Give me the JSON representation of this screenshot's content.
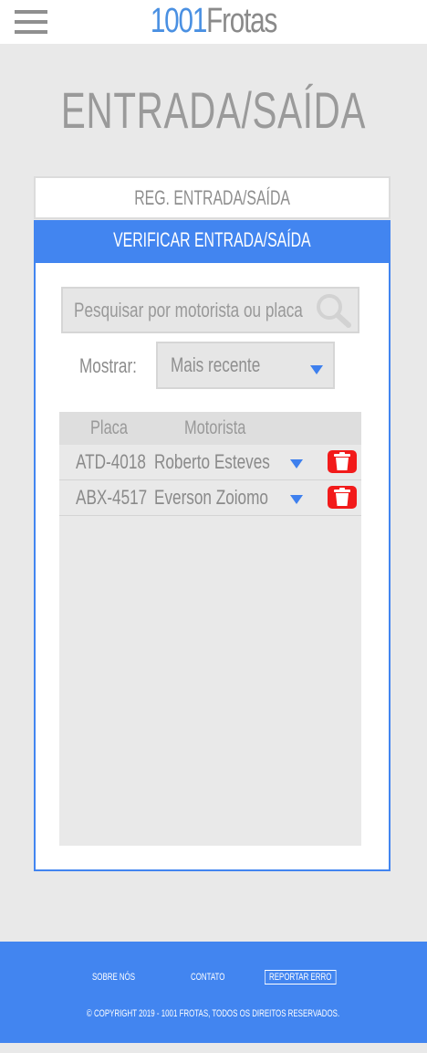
{
  "header": {
    "brand_number": "1001",
    "brand_name": "Frotas",
    "menu_icon": "hamburger-menu-icon"
  },
  "page_title": "ENTRADA/SAÍDA",
  "tabs": {
    "register": "REG. ENTRADA/SAÍDA",
    "verify": "VERIFICAR ENTRADA/SAÍDA"
  },
  "search": {
    "placeholder": "Pesquisar por motorista ou placa",
    "icon": "search-icon"
  },
  "filter": {
    "label": "Mostrar:",
    "selected": "Mais recente"
  },
  "table": {
    "columns": [
      "Placa",
      "Motorista"
    ],
    "rows": [
      {
        "plate": "ATD-4018",
        "driver": "Roberto Esteves"
      },
      {
        "plate": "ABX-4517",
        "driver": "Everson Zoiomo"
      }
    ]
  },
  "footer": {
    "about": "SOBRE NÓS",
    "contact": "CONTATO",
    "report": "REPORTAR ERRO",
    "copyright": "© COPYRIGHT 2019 - 1001 FROTAS, TODOS OS DIREITOS RESERVADOS."
  },
  "colors": {
    "accent": "#4285f0",
    "delete": "#f21a1a"
  }
}
